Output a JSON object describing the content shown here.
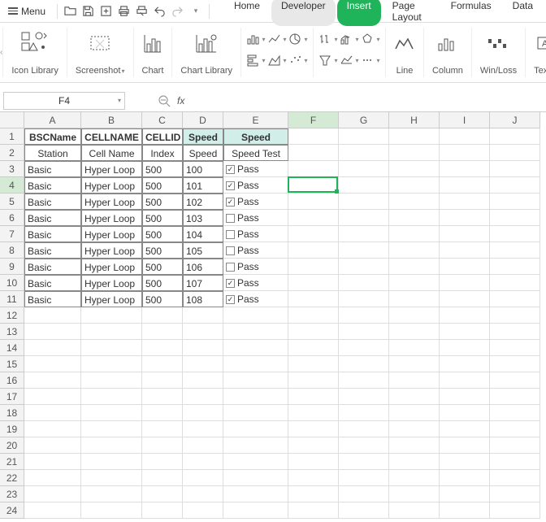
{
  "menubar": {
    "menu_label": "Menu",
    "tabs": [
      "Home",
      "Developer",
      "Insert",
      "Page Layout",
      "Formulas",
      "Data"
    ]
  },
  "ribbon": {
    "icon_library": "Icon Library",
    "screenshot": "Screenshot",
    "chart": "Chart",
    "chart_library": "Chart Library",
    "line": "Line",
    "column": "Column",
    "winloss": "Win/Loss",
    "textbox": "Text B"
  },
  "formula_bar": {
    "name_box": "F4",
    "fx": "fx",
    "formula": ""
  },
  "grid": {
    "columns": [
      "A",
      "B",
      "C",
      "D",
      "E",
      "F",
      "G",
      "H",
      "I",
      "J"
    ],
    "active_col": "F",
    "active_row": 4,
    "header1": [
      "BSCName",
      "CELLNAME",
      "CELLID",
      "Speed",
      "Speed"
    ],
    "header2": [
      "Station",
      "Cell Name",
      "Index",
      "Speed",
      "Speed Test"
    ],
    "data_rows": [
      {
        "a": "Basic",
        "b": "Hyper Loop",
        "c": "500",
        "d": "100",
        "checked": true,
        "e": "Pass"
      },
      {
        "a": "Basic",
        "b": "Hyper Loop",
        "c": "500",
        "d": "101",
        "checked": true,
        "e": "Pass"
      },
      {
        "a": "Basic",
        "b": "Hyper Loop",
        "c": "500",
        "d": "102",
        "checked": true,
        "e": "Pass"
      },
      {
        "a": "Basic",
        "b": "Hyper Loop",
        "c": "500",
        "d": "103",
        "checked": false,
        "e": "Pass"
      },
      {
        "a": "Basic",
        "b": "Hyper Loop",
        "c": "500",
        "d": "104",
        "checked": false,
        "e": "Pass"
      },
      {
        "a": "Basic",
        "b": "Hyper Loop",
        "c": "500",
        "d": "105",
        "checked": false,
        "e": "Pass"
      },
      {
        "a": "Basic",
        "b": "Hyper Loop",
        "c": "500",
        "d": "106",
        "checked": false,
        "e": "Pass"
      },
      {
        "a": "Basic",
        "b": "Hyper Loop",
        "c": "500",
        "d": "107",
        "checked": true,
        "e": "Pass"
      },
      {
        "a": "Basic",
        "b": "Hyper Loop",
        "c": "500",
        "d": "108",
        "checked": true,
        "e": "Pass"
      }
    ],
    "visible_rows": 24
  }
}
